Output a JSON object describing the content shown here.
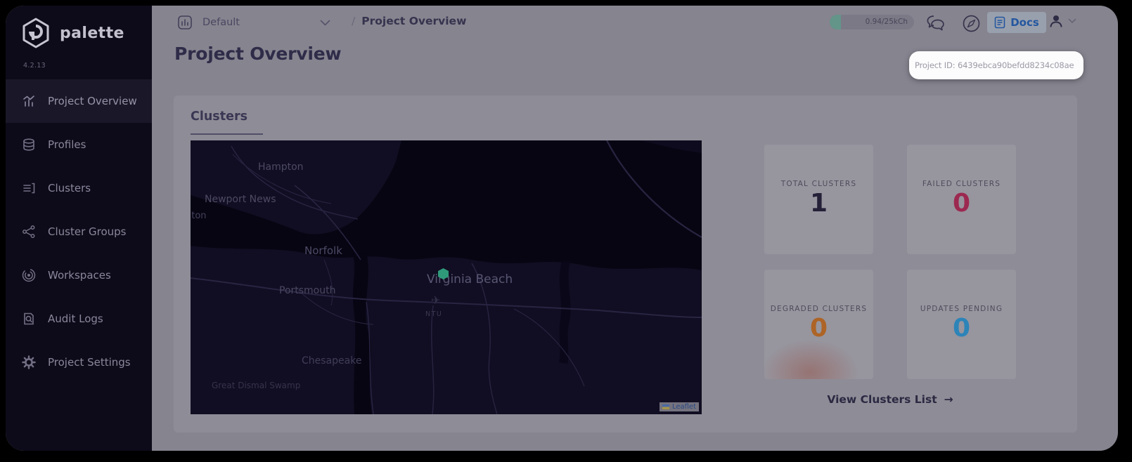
{
  "app": {
    "name": "palette",
    "version": "4.2.13"
  },
  "sidebar": {
    "items": [
      {
        "label": "Project Overview",
        "icon": "analytics-chart-icon",
        "active": true
      },
      {
        "label": "Profiles",
        "icon": "layers-stack-icon",
        "active": false
      },
      {
        "label": "Clusters",
        "icon": "list-icon",
        "active": false
      },
      {
        "label": "Cluster Groups",
        "icon": "node-network-icon",
        "active": false
      },
      {
        "label": "Workspaces",
        "icon": "concentric-circles-icon",
        "active": false
      },
      {
        "label": "Audit Logs",
        "icon": "document-search-icon",
        "active": false
      },
      {
        "label": "Project Settings",
        "icon": "gear-icon",
        "active": false
      }
    ]
  },
  "topbar": {
    "selector": {
      "value": "Default",
      "icon": "bar-chart-icon"
    },
    "breadcrumb": {
      "separator": "/",
      "current": "Project Overview"
    },
    "usage": {
      "value": "0.94/25kCh"
    },
    "docs_label": "Docs",
    "icons": [
      "chat-bubbles-icon",
      "compass-help-icon",
      "document-icon",
      "user-icon",
      "chevron-down-icon"
    ]
  },
  "page": {
    "title": "Project Overview"
  },
  "tooltip": {
    "text": "Project ID: 6439ebca90befdd8234c08ae"
  },
  "panel": {
    "title": "Clusters",
    "link": {
      "label": "View Clusters List",
      "arrow": "→"
    }
  },
  "map": {
    "provider_attribution": "Leaflet",
    "marker": {
      "color": "#2f9a7a",
      "near": "Virginia Beach"
    },
    "labels": [
      {
        "text": "Hampton"
      },
      {
        "text": "Newport News"
      },
      {
        "text": "llton"
      },
      {
        "text": "Norfolk"
      },
      {
        "text": "Virginia Beach"
      },
      {
        "text": "Portsmouth"
      },
      {
        "text": "NTU"
      },
      {
        "text": "Chesapeake"
      },
      {
        "text": "Great Dismal Swamp"
      }
    ],
    "airplane_glyph": "✈"
  },
  "stats": [
    {
      "label": "TOTAL CLUSTERS",
      "value": "1",
      "color": "#242138"
    },
    {
      "label": "FAILED CLUSTERS",
      "value": "0",
      "color": "#9c2950"
    },
    {
      "label": "DEGRADED CLUSTERS",
      "value": "0",
      "color": "#ad6426"
    },
    {
      "label": "UPDATES PENDING",
      "value": "0",
      "color": "#2c84b8"
    }
  ],
  "accent_colors": {
    "sidebar_bg": "#0d0b19",
    "dim_background": "#86848f",
    "card_bg": "#8e8c96",
    "tile_bg": "#97959e",
    "docs_blue": "#24579f",
    "usage_teal": "#5f9a8a",
    "marker_green": "#2f9a7a",
    "tooltip_bg": "#fcfcfd"
  }
}
